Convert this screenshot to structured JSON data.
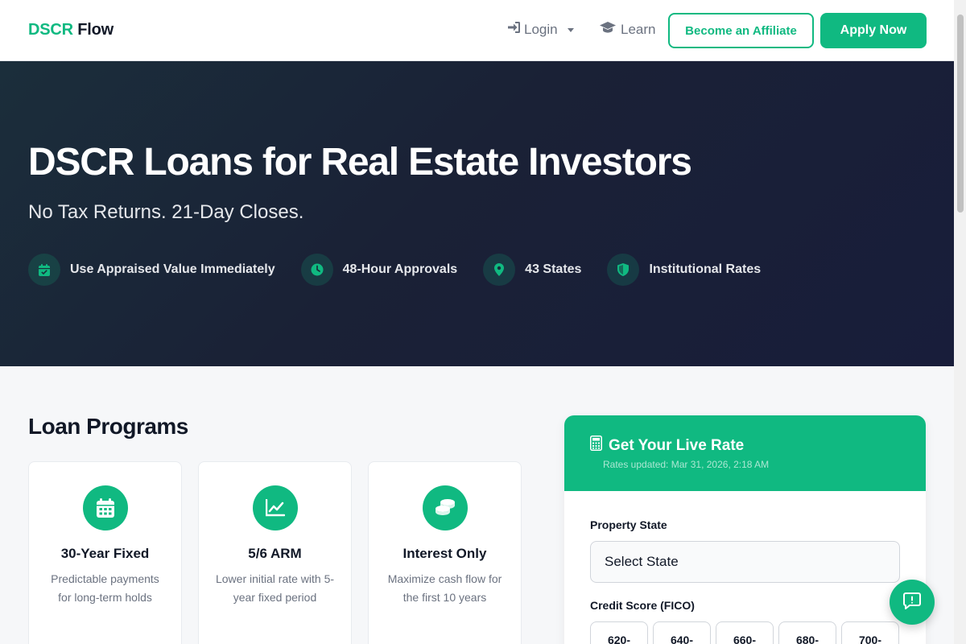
{
  "nav": {
    "brand_primary": "DSCR",
    "brand_secondary": " Flow",
    "login_label": "Login",
    "learn_label": "Learn",
    "affiliate_label": "Become an Affiliate",
    "apply_label": "Apply Now"
  },
  "hero": {
    "title": "DSCR Loans for Real Estate Investors",
    "subtitle": "No Tax Returns. 21-Day Closes.",
    "features": [
      {
        "label": "Use Appraised Value Immediately",
        "icon": "calendar-check-icon"
      },
      {
        "label": "48-Hour Approvals",
        "icon": "clock-icon"
      },
      {
        "label": "43 States",
        "icon": "map-pin-icon"
      },
      {
        "label": "Institutional Rates",
        "icon": "shield-icon"
      }
    ]
  },
  "loan_programs": {
    "title": "Loan Programs",
    "cards": [
      {
        "title": "30-Year Fixed",
        "desc": "Predictable payments for long-term holds",
        "icon": "calendar-icon"
      },
      {
        "title": "5/6 ARM",
        "desc": "Lower initial rate with 5-year fixed period",
        "icon": "chart-line-icon"
      },
      {
        "title": "Interest Only",
        "desc": "Maximize cash flow for the first 10 years",
        "icon": "coins-icon"
      }
    ]
  },
  "rate_panel": {
    "title": "Get Your Live Rate",
    "updated": "Rates updated: Mar 31, 2026, 2:18 AM",
    "state_label": "Property State",
    "state_placeholder": "Select State",
    "fico_label": "Credit Score (FICO)",
    "fico_options": [
      "620-",
      "640-",
      "660-",
      "680-",
      "700-"
    ]
  },
  "colors": {
    "accent": "#10b981",
    "hero_bg": "#1a2136",
    "text_dark": "#111827",
    "text_muted": "#6b7280"
  }
}
